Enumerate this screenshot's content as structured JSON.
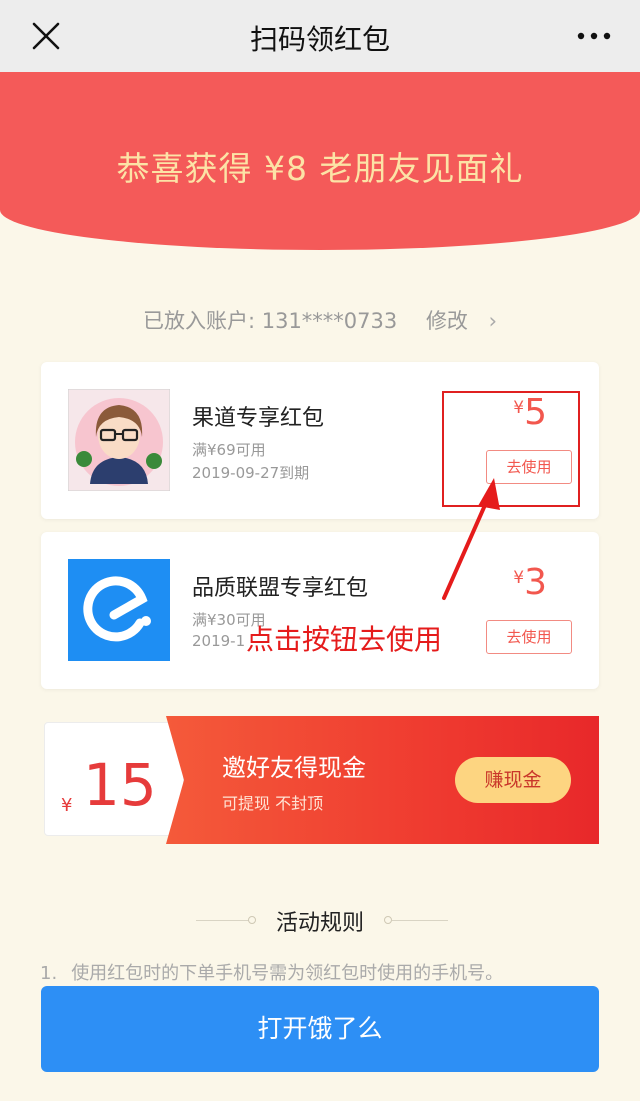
{
  "nav": {
    "title": "扫码领红包",
    "close_icon": "close-icon",
    "more_icon": "more-icon"
  },
  "banner": {
    "text": "恭喜获得 ¥8 老朋友见面礼"
  },
  "account": {
    "label": "已放入账户: 131****0733",
    "edit": "修改",
    "chevron": "›"
  },
  "coupons": [
    {
      "name": "果道专享红包",
      "condition": "满¥69可用",
      "expiry": "2019-09-27到期",
      "currency": "¥",
      "amount": "5",
      "button": "去使用",
      "logo": "avatar-logo"
    },
    {
      "name": "品质联盟专享红包",
      "condition": "满¥30可用",
      "expiry": "2019-1",
      "currency": "¥",
      "amount": "3",
      "button": "去使用",
      "logo": "eleme-logo"
    }
  ],
  "annotation": {
    "text": "点击按钮去使用"
  },
  "invite": {
    "currency": "¥",
    "amount": "15",
    "title": "邀好友得现金",
    "subtitle": "可提现 不封顶",
    "button": "赚现金"
  },
  "rules": {
    "title": "活动规则",
    "items": [
      {
        "index": "1.",
        "text": "使用红包时的下单手机号需为领红包时使用的手机号。"
      }
    ]
  },
  "bottom": {
    "button": "打开饿了么"
  },
  "colors": {
    "banner": "#f45a59",
    "accent_red": "#f2574e",
    "primary_blue": "#2d8ff5",
    "gold": "#fdd581"
  }
}
